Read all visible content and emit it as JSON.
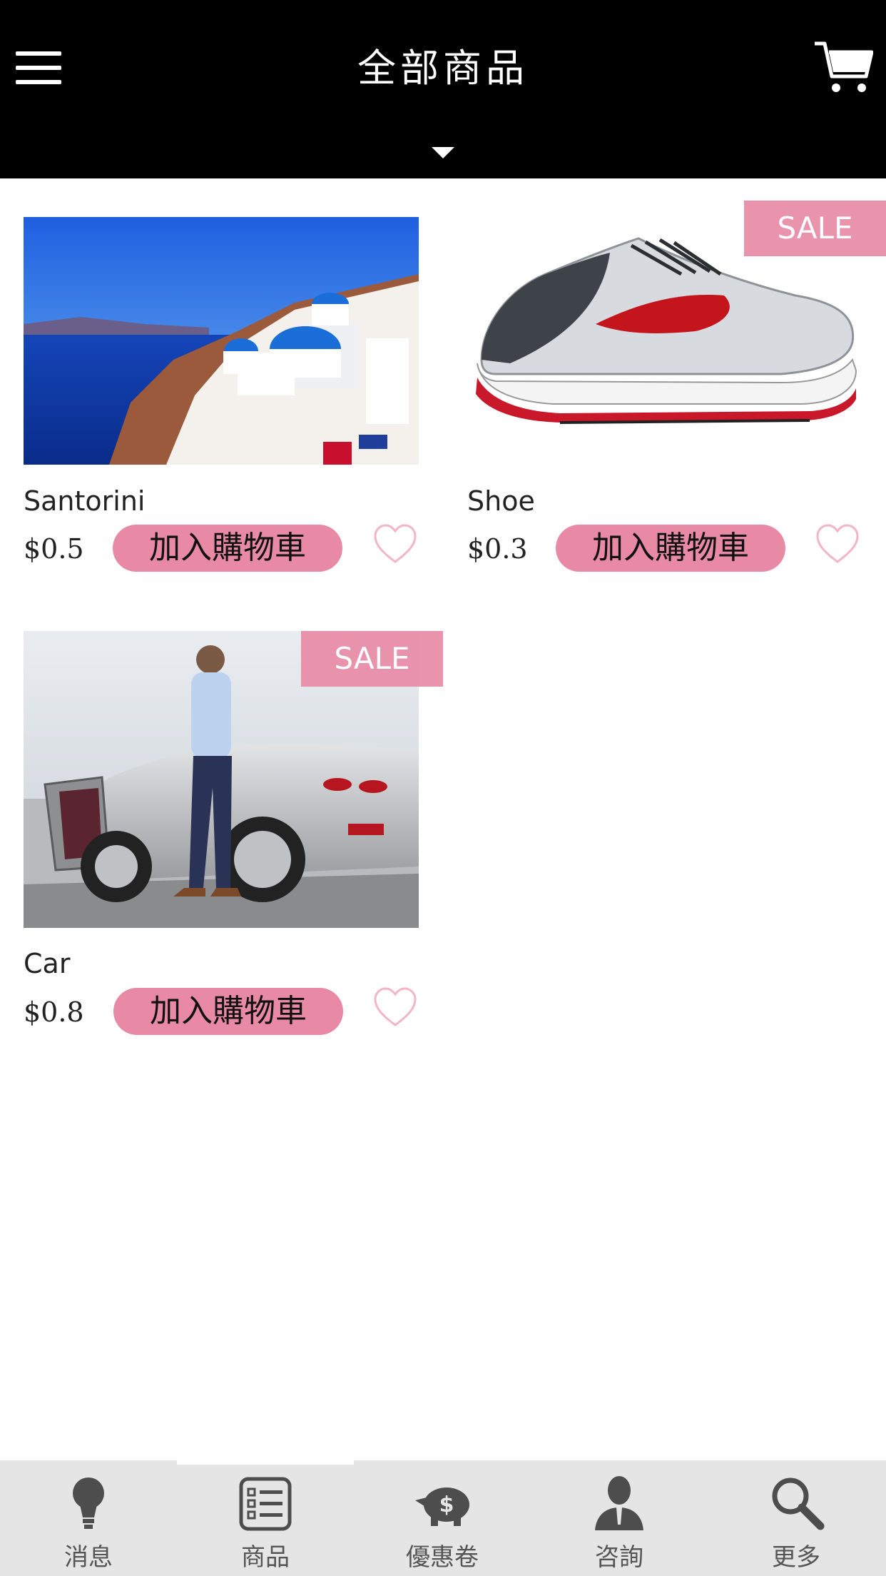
{
  "header": {
    "title": "全部商品",
    "menu_icon": "hamburger-menu-icon",
    "cart_icon": "shopping-cart-icon",
    "dropdown_icon": "caret-down-icon"
  },
  "products": [
    {
      "name": "Santorini",
      "price": "$0.5",
      "button_label": "加入購物車",
      "sale": false,
      "image": "santorini-photo"
    },
    {
      "name": "Shoe",
      "price": "$0.3",
      "button_label": "加入購物車",
      "sale": true,
      "sale_label": "SALE",
      "image": "running-shoe-photo"
    },
    {
      "name": "Car",
      "price": "$0.8",
      "button_label": "加入購物車",
      "sale": true,
      "sale_label": "SALE",
      "image": "man-with-convertible-photo"
    }
  ],
  "tabbar": {
    "active_index": 1,
    "tabs": [
      {
        "label": "消息",
        "icon": "lightbulb-icon"
      },
      {
        "label": "商品",
        "icon": "checklist-icon"
      },
      {
        "label": "優惠卷",
        "icon": "piggy-bank-icon"
      },
      {
        "label": "咨詢",
        "icon": "person-icon"
      },
      {
        "label": "更多",
        "icon": "magnifier-icon"
      }
    ]
  },
  "colors": {
    "header_bg": "#000000",
    "accent_pink": "#e88aa6",
    "tabbar_bg": "#e6e5e6"
  }
}
